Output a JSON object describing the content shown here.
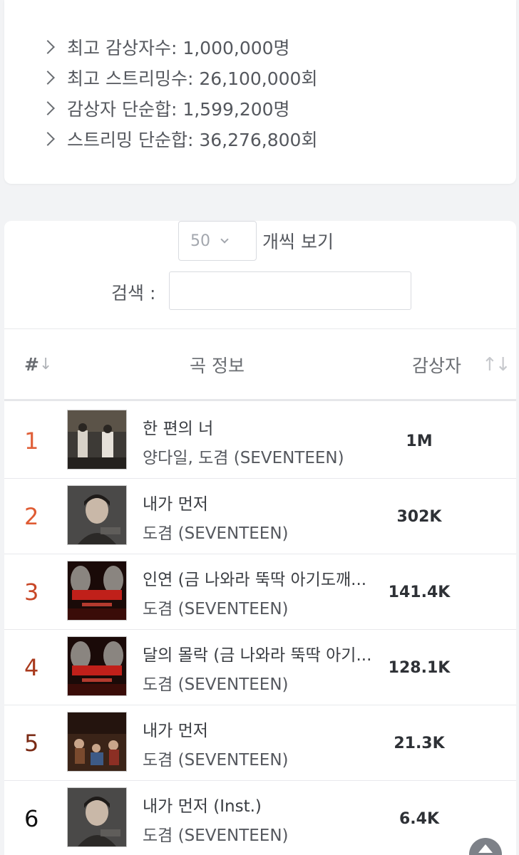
{
  "stats": [
    "최고 감상자수: 1,000,000명",
    "최고 스트리밍수: 26,100,000회",
    "감상자 단순합: 1,599,200명",
    "스트리밍 단순합: 36,276,800회"
  ],
  "controls": {
    "per_page_value": "50",
    "per_page_label": "개씩 보기",
    "search_label": "검색 :",
    "search_value": ""
  },
  "table": {
    "headers": {
      "rank": "#",
      "song": "곡 정보",
      "listeners": "감상자"
    },
    "rows": [
      {
        "rank": "1",
        "rank_color": "#e0603a",
        "title": "한 편의 너",
        "artist": "양다일, 도겸 (SEVENTEEN)",
        "count": "1M",
        "thumb_icon": "album-cover-duet"
      },
      {
        "rank": "2",
        "rank_color": "#df5b33",
        "title": "내가 먼저",
        "artist": "도겸 (SEVENTEEN)",
        "count": "302K",
        "thumb_icon": "album-cover-portrait"
      },
      {
        "rank": "3",
        "rank_color": "#c84727",
        "title": "인연 (금 나와라 뚝딱 아기도깨...",
        "artist": "도겸 (SEVENTEEN)",
        "count": "141.4K",
        "thumb_icon": "album-cover-red-poster"
      },
      {
        "rank": "4",
        "rank_color": "#a93a1d",
        "title": "달의 몰락 (금 나와라 뚝딱 아기...",
        "artist": "도겸 (SEVENTEEN)",
        "count": "128.1K",
        "thumb_icon": "album-cover-red-poster"
      },
      {
        "rank": "5",
        "rank_color": "#7a2a14",
        "title": "내가 먼저",
        "artist": "도겸 (SEVENTEEN)",
        "count": "21.3K",
        "thumb_icon": "album-cover-drama"
      },
      {
        "rank": "6",
        "rank_color": "#111111",
        "title": "내가 먼저 (Inst.)",
        "artist": "도겸 (SEVENTEEN)",
        "count": "6.4K",
        "thumb_icon": "album-cover-portrait"
      }
    ]
  }
}
